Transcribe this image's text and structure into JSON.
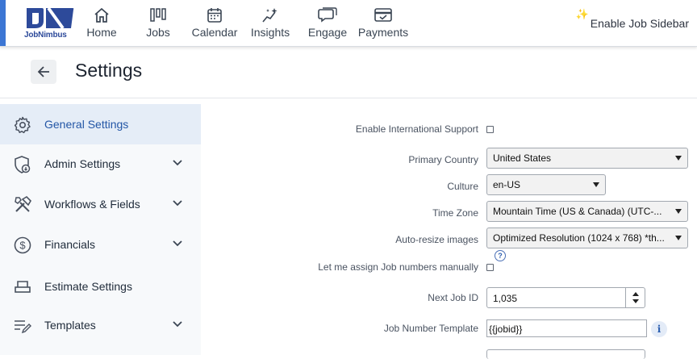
{
  "brand": {
    "name": "JobNimbus",
    "logo_color": "#2d4a9a",
    "accent": "#3c76d4"
  },
  "nav": {
    "items": [
      {
        "label": "Home",
        "icon": "home-icon"
      },
      {
        "label": "Jobs",
        "icon": "jobs-board-icon"
      },
      {
        "label": "Calendar",
        "icon": "calendar-icon"
      },
      {
        "label": "Insights",
        "icon": "insights-sparkle-chart-icon"
      },
      {
        "label": "Engage",
        "icon": "chat-bubbles-icon"
      },
      {
        "label": "Payments",
        "icon": "payment-card-icon"
      }
    ],
    "sidebar_toggle": {
      "label": "Enable Job Sidebar",
      "icon": "sparkle-icon"
    }
  },
  "page": {
    "title": "Settings",
    "back_icon": "back-arrow-icon"
  },
  "sidebar": {
    "active_color": "#2356a6",
    "items": [
      {
        "label": "General Settings",
        "icon": "gear-icon",
        "active": true
      },
      {
        "label": "Admin Settings",
        "icon": "admin-shield-icon",
        "expandable": true
      },
      {
        "label": "Workflows & Fields",
        "icon": "tools-icon",
        "expandable": true
      },
      {
        "label": "Financials",
        "icon": "dollar-circle-icon",
        "expandable": true
      },
      {
        "label": "Estimate Settings",
        "icon": "printer-icon"
      },
      {
        "label": "Templates",
        "icon": "edit-list-icon",
        "expandable": true
      }
    ]
  },
  "form": {
    "international_support": {
      "label": "Enable International Support",
      "checked": false
    },
    "primary_country": {
      "label": "Primary Country",
      "value": "United States"
    },
    "culture": {
      "label": "Culture",
      "value": "en-US"
    },
    "time_zone": {
      "label": "Time Zone",
      "value": "Mountain Time (US & Canada) (UTC-..."
    },
    "auto_resize": {
      "label": "Auto-resize images",
      "value": "Optimized Resolution (1024 x 768) *th...",
      "help": "?"
    },
    "manual_job_numbers": {
      "label": "Let me assign Job numbers manually",
      "checked": false
    },
    "next_job_id": {
      "label": "Next Job ID",
      "value": "1,035"
    },
    "job_number_template": {
      "label": "Job Number Template",
      "value": "{{jobid}}",
      "info": "i"
    }
  }
}
